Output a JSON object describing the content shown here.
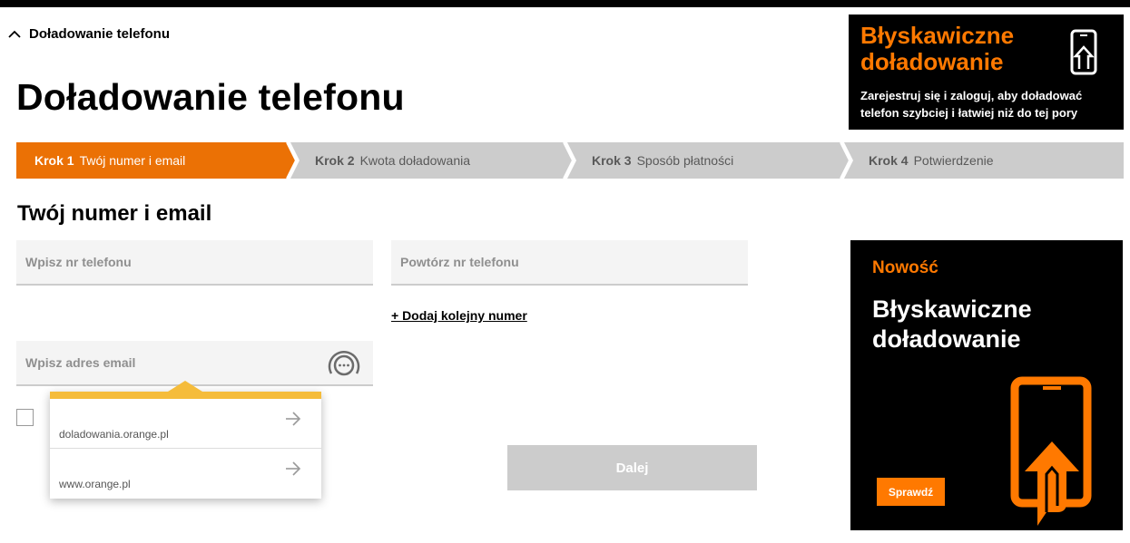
{
  "breadcrumb": {
    "label": "Doładowanie telefonu",
    "icon": "chevron-up-icon"
  },
  "page": {
    "title": "Doładowanie telefonu"
  },
  "promo_top": {
    "title": "Błyskawiczne doładowanie",
    "text": "Zarejestruj się i zaloguj, aby doładować telefon szybciej i łatwiej niż do tej pory",
    "icon": "phone-arrow-icon"
  },
  "steps": [
    {
      "num": "Krok 1",
      "label": "Twój numer i email",
      "active": true
    },
    {
      "num": "Krok 2",
      "label": "Kwota doładowania",
      "active": false
    },
    {
      "num": "Krok 3",
      "label": "Sposób płatności",
      "active": false
    },
    {
      "num": "Krok 4",
      "label": "Potwierdzenie",
      "active": false
    }
  ],
  "form": {
    "section_title": "Twój numer i email",
    "phone_placeholder": "Wpisz nr telefonu",
    "phone_repeat_placeholder": "Powtórz nr telefonu",
    "add_number": "+ Dodaj kolejny numer",
    "email_placeholder": "Wpisz adres email",
    "password_manager_icon": "password-manager-icon",
    "next_button": "Dalej"
  },
  "suggestions": [
    {
      "label": "doladowania.orange.pl",
      "icon": "arrow-right-icon"
    },
    {
      "label": "www.orange.pl",
      "icon": "arrow-right-icon"
    }
  ],
  "promo_side": {
    "badge": "Nowość",
    "title": "Błyskawiczne doładowanie",
    "button": "Sprawdź",
    "icon": "phone-arrow-icon"
  },
  "colors": {
    "accent": "#ff7900",
    "step_active": "#eb7105",
    "step_inactive": "#cccccc",
    "dropdown_bar": "#f5bc3b",
    "button_disabled": "#cccccc",
    "banner_bg": "#000000"
  }
}
